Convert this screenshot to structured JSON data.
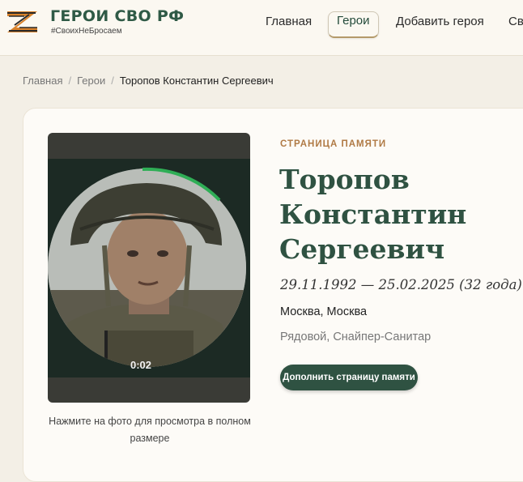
{
  "header": {
    "brand_title": "ГЕРОИ СВО РФ",
    "brand_tagline": "#СвоихНеБросаем",
    "nav": {
      "home": "Главная",
      "heroes": "Герои",
      "add_hero": "Добавить героя",
      "more": "Св"
    },
    "logo_icon": "ribbon-z-logo-icon",
    "colors": {
      "brand_green": "#2f5a46",
      "ribbon_orange": "#d9822b"
    }
  },
  "breadcrumb": {
    "home": "Главная",
    "heroes": "Герои",
    "current": "Торопов Константин Сергеевич"
  },
  "profile": {
    "section_label": "СТРАНИЦА ПАМЯТИ",
    "name": "Торопов Константин Сергеевич",
    "dates": "29.11.1992 — 25.02.2025 (32 года)",
    "location": "Москва, Москва",
    "rank": "Рядовой, Снайпер-Санитар",
    "action_button": "Дополнить страницу памяти",
    "photo": {
      "video_time": "0:02",
      "caption": "Нажмите на фото для просмотра в полном размере"
    },
    "colors": {
      "accent_label": "#b07a45",
      "name_green": "#2f5242",
      "button_green": "#2f5242"
    }
  }
}
